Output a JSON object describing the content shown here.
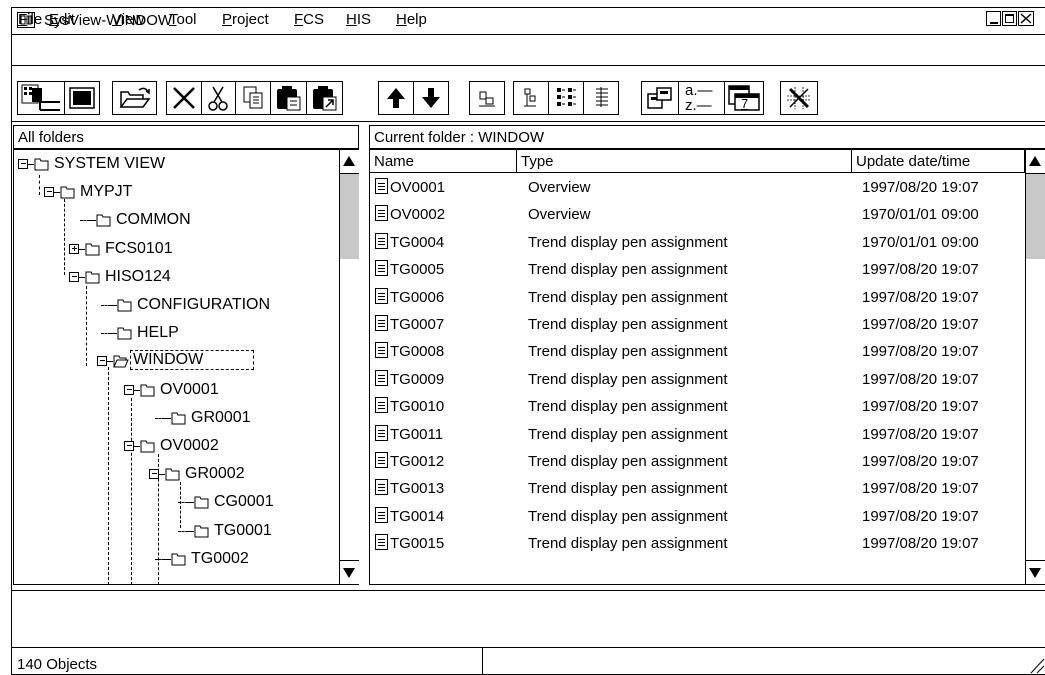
{
  "window": {
    "title": "SysView-WINDOW"
  },
  "menu": [
    {
      "label": "File",
      "u": "F",
      "rest": "ile"
    },
    {
      "label": "Edit",
      "u": "E",
      "rest": "dit"
    },
    {
      "label": "View",
      "u": "V",
      "rest": "iew"
    },
    {
      "label": "Tool",
      "u": "T",
      "rest": "ool"
    },
    {
      "label": "Project",
      "u": "P",
      "rest": "roject"
    },
    {
      "label": "FCS",
      "u": "F",
      "rest": "CS"
    },
    {
      "label": "HIS",
      "u": "H",
      "rest": "IS"
    },
    {
      "label": "Help",
      "u": "H",
      "rest": "elp"
    }
  ],
  "toolbar": {
    "sort_label_a": "a.—",
    "sort_label_z": "z.—",
    "calendar_num": "7"
  },
  "left_pane": {
    "header": "All folders"
  },
  "right_pane": {
    "header": "Current folder : WINDOW",
    "columns": [
      "Name",
      "Type",
      "Update date/time"
    ]
  },
  "tree": [
    {
      "label": "SYSTEM VIEW",
      "expander": "-"
    },
    {
      "label": "MYPJT",
      "expander": "-"
    },
    {
      "label": "COMMON",
      "expander": ""
    },
    {
      "label": "FCS0101",
      "expander": "+"
    },
    {
      "label": "HISO124",
      "expander": "-"
    },
    {
      "label": "CONFIGURATION",
      "expander": ""
    },
    {
      "label": "HELP",
      "expander": ""
    },
    {
      "label": "WINDOW",
      "expander": "-",
      "selected": true
    },
    {
      "label": "OV0001",
      "expander": "-"
    },
    {
      "label": "GR0001",
      "expander": ""
    },
    {
      "label": "OV0002",
      "expander": "-"
    },
    {
      "label": "GR0002",
      "expander": "-"
    },
    {
      "label": "CG0001",
      "expander": ""
    },
    {
      "label": "TG0001",
      "expander": ""
    },
    {
      "label": "TG0002",
      "expander": ""
    }
  ],
  "rows": [
    {
      "name": "OV0001",
      "type": "Overview",
      "date": "1997/08/20 19:07"
    },
    {
      "name": "OV0002",
      "type": "Overview",
      "date": "1970/01/01 09:00"
    },
    {
      "name": "TG0004",
      "type": "Trend display pen assignment",
      "date": "1970/01/01 09:00"
    },
    {
      "name": "TG0005",
      "type": "Trend display pen assignment",
      "date": "1997/08/20 19:07"
    },
    {
      "name": "TG0006",
      "type": "Trend display pen assignment",
      "date": "1997/08/20 19:07"
    },
    {
      "name": "TG0007",
      "type": "Trend display pen assignment",
      "date": "1997/08/20 19:07"
    },
    {
      "name": "TG0008",
      "type": "Trend display pen assignment",
      "date": "1997/08/20 19:07"
    },
    {
      "name": "TG0009",
      "type": "Trend display pen assignment",
      "date": "1997/08/20 19:07"
    },
    {
      "name": "TG0010",
      "type": "Trend display pen assignment",
      "date": "1997/08/20 19:07"
    },
    {
      "name": "TG0011",
      "type": "Trend display pen assignment",
      "date": "1997/08/20 19:07"
    },
    {
      "name": "TG0012",
      "type": "Trend display pen assignment",
      "date": "1997/08/20 19:07"
    },
    {
      "name": "TG0013",
      "type": "Trend display pen assignment",
      "date": "1997/08/20 19:07"
    },
    {
      "name": "TG0014",
      "type": "Trend display pen assignment",
      "date": "1997/08/20 19:07"
    },
    {
      "name": "TG0015",
      "type": "Trend display pen assignment",
      "date": "1997/08/20 19:07"
    }
  ],
  "status": {
    "count": "140 Objects"
  },
  "icons": {
    "system": "window-system-icon",
    "minimize": "minimize-icon",
    "maximize": "maximize-icon",
    "close": "close-icon",
    "folder": "folder-icon",
    "document": "document-icon"
  }
}
